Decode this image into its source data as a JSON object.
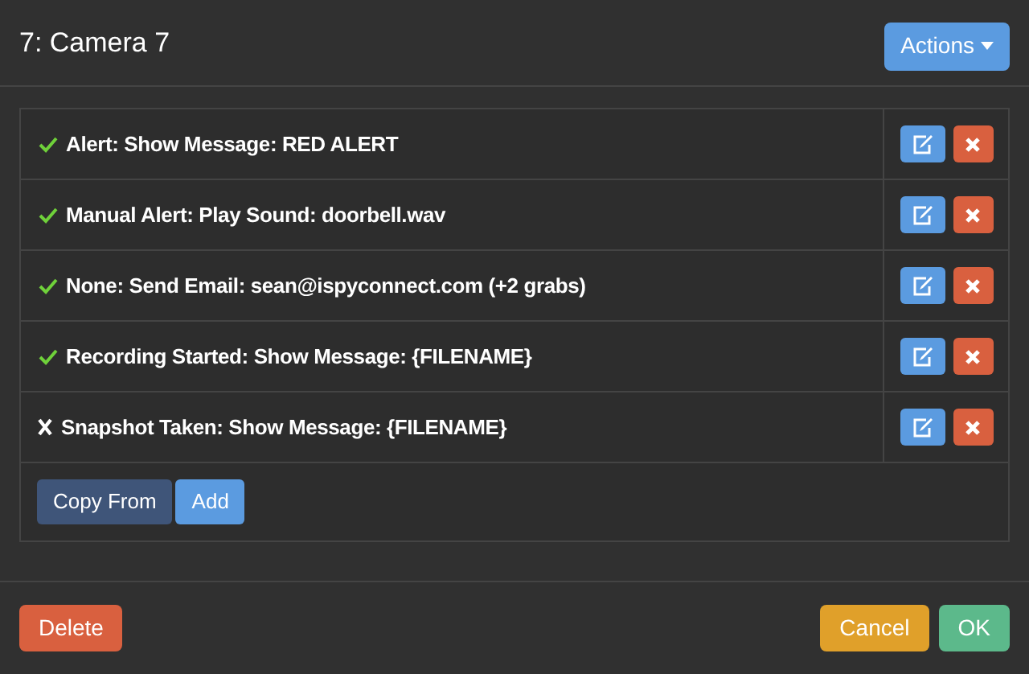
{
  "title": "7: Camera 7",
  "actions_button": "Actions",
  "events": [
    {
      "text": "Alert: Show Message: RED ALERT",
      "enabled": true
    },
    {
      "text": "Manual Alert: Play Sound: doorbell.wav",
      "enabled": true
    },
    {
      "text": "None: Send Email: sean@ispyconnect.com (+2 grabs)",
      "enabled": true
    },
    {
      "text": "Recording Started: Show Message: {FILENAME}",
      "enabled": true
    },
    {
      "text": "Snapshot Taken: Show Message: {FILENAME}",
      "enabled": false
    }
  ],
  "list_buttons": [
    "Copy From",
    "Add"
  ],
  "footer": {
    "delete": "Delete",
    "cancel": "Cancel",
    "ok": "OK"
  }
}
